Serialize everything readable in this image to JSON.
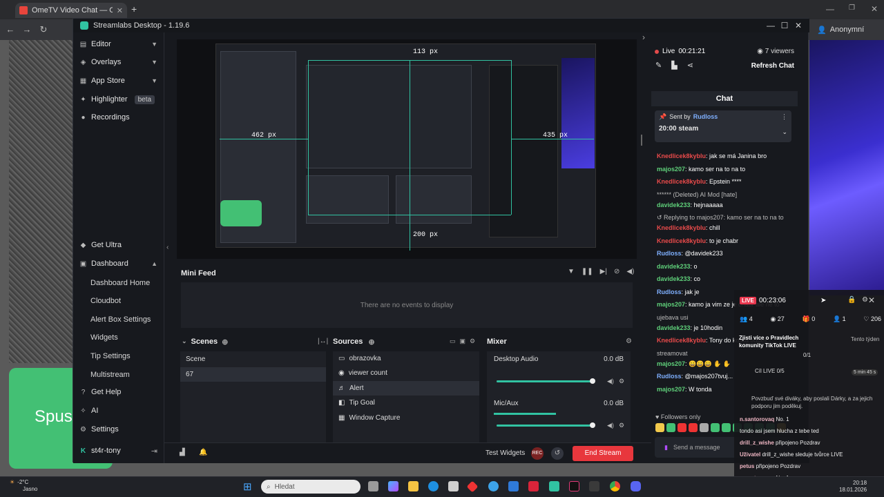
{
  "browser": {
    "tab_title": "OmeTV Video Chat — Ome",
    "new_tab": "+",
    "profile_label": "Anonymní"
  },
  "page": {
    "start_button": "Spust"
  },
  "app": {
    "title": "Streamlabs Desktop - 1.19.6",
    "nav": {
      "editor": "Editor",
      "overlays": "Overlays",
      "app_store": "App Store",
      "highlighter": "Highlighter",
      "highlighter_badge": "beta",
      "recordings": "Recordings",
      "get_ultra": "Get Ultra",
      "dashboard": "Dashboard",
      "dashboard_home": "Dashboard Home",
      "cloudbot": "Cloudbot",
      "alert_box": "Alert Box Settings",
      "widgets": "Widgets",
      "tip_settings": "Tip Settings",
      "multistream": "Multistream",
      "get_help": "Get Help",
      "ai": "AI",
      "settings": "Settings",
      "user": "st4r-tony"
    },
    "preview": {
      "measure_top": "113 px",
      "measure_left": "462 px",
      "measure_right": "435 px",
      "measure_bottom": "200 px"
    },
    "mini_feed": {
      "title": "Mini Feed",
      "empty": "There are no events to display"
    },
    "scenes": {
      "title": "Scenes",
      "header": "Scene",
      "items": [
        "67"
      ]
    },
    "sources": {
      "title": "Sources",
      "items": [
        "obrazovka",
        "viewer count",
        "Alert",
        "Tip Goal",
        "Window Capture"
      ]
    },
    "mixer": {
      "title": "Mixer",
      "channels": [
        {
          "name": "Desktop Audio",
          "level": "0.0 dB",
          "fill": 0.98
        },
        {
          "name": "Mic/Aux",
          "level": "0.0 dB",
          "fill": 0.98
        }
      ]
    },
    "bottom": {
      "test_widgets": "Test Widgets",
      "rec": "REC",
      "end_stream": "End Stream"
    }
  },
  "chat": {
    "live_label": "Live",
    "live_time": "00:21:21",
    "viewers": "7 viewers",
    "refresh": "Refresh Chat",
    "header": "Chat",
    "pinned_by": "Sent by",
    "pinned_user": "Rudloss",
    "pinned_text": "20:00 steam",
    "messages": [
      {
        "user": "Knedlicek8kyblu",
        "text": ": jak se má Janina bro",
        "color": "red"
      },
      {
        "user": "majos207",
        "text": ": kamo ser na to na to",
        "color": "green"
      },
      {
        "user": "Knedlicek8kyblu",
        "text": ": Epstein ****",
        "color": "red"
      },
      {
        "user": "",
        "text": "****** (Deleted) AI Mod [hate]",
        "color": "none"
      },
      {
        "user": "davidek233",
        "text": ": hejnaaaaa",
        "color": "green"
      },
      {
        "user": "",
        "text": "↺ Replying to majos207: kamo ser na to na to",
        "color": "none"
      },
      {
        "user": "Knedlicek8kyblu",
        "text": ": chill",
        "color": "red"
      },
      {
        "user": "Knedlicek8kyblu",
        "text": ": to je chabr",
        "color": "red"
      },
      {
        "user": "Rudloss",
        "text": ": @davidek233",
        "color": "blue"
      },
      {
        "user": "davidek233",
        "text": ": o",
        "color": "green"
      },
      {
        "user": "davidek233",
        "text": ": co",
        "color": "green"
      },
      {
        "user": "Rudloss",
        "text": ": jak je",
        "color": "blue"
      },
      {
        "user": "majos207",
        "text": ": kamo ja vim ze je chabr ale ne to",
        "color": "green"
      },
      {
        "user": "",
        "text": "ujebava usi",
        "color": "none"
      },
      {
        "user": "davidek233",
        "text": ": je 10hodin",
        "color": "green"
      },
      {
        "user": "Knedlicek8kyblu",
        "text": ": Tony do kolika budeš",
        "color": "red"
      },
      {
        "user": "",
        "text": "streamovat",
        "color": "none"
      },
      {
        "user": "majos207",
        "text": ": 😄😄😄 ✋ ✋",
        "color": "green"
      },
      {
        "user": "Rudloss",
        "text": ": @majos207tvuj...",
        "color": "blue"
      },
      {
        "user": "majos207",
        "text": ": W tonda",
        "color": "green"
      }
    ],
    "followers_only": "♥ Followers only",
    "send_placeholder": "Send a message"
  },
  "tiktok": {
    "live": "LIVE",
    "time": "00:23:06",
    "stats": [
      "4",
      "27",
      "0",
      "1",
      "206"
    ],
    "rules": "Zjisti více o Pravidlech komunity TikTok LIVE",
    "progress": "0/1",
    "cili": "Cíl LIVE 0/5",
    "timer": "5 min 45 s",
    "this_week": "Tento týden",
    "gift_prompt": "Povzbuď své diváky, aby poslali Dárky, a za jejich podporu jim poděkuj.",
    "messages": [
      {
        "name": "n.santorovaq",
        "text": "No. 1"
      },
      {
        "name": "",
        "text": "tondo asi jsem hlucha z tebe ted"
      },
      {
        "name": "drill_z_wishe",
        "text": "připojeno   Pozdrav"
      },
      {
        "name": "Uživatel",
        "text": "drill_z_wishe sleduje tvůrce LIVE"
      },
      {
        "name": "petus",
        "text": "připojeno   Pozdrav"
      },
      {
        "name": "n.santorovaq",
        "text": "No. 1"
      }
    ]
  },
  "taskbar": {
    "temp": "-2°C",
    "weather": "Jasno",
    "search": "Hledat",
    "time": "20:18",
    "date": "18.01.2026"
  }
}
